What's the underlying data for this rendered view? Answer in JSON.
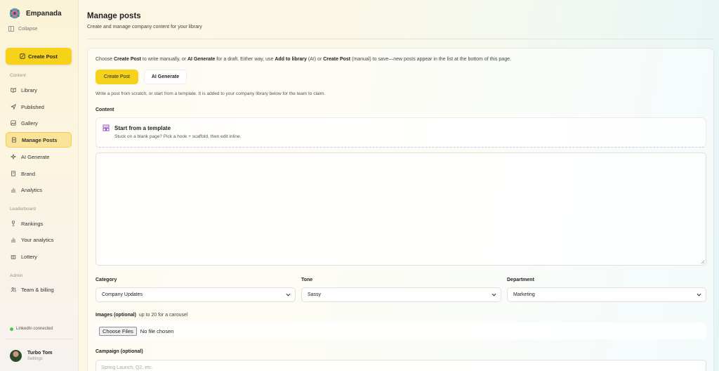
{
  "app": {
    "name": "Empanada",
    "collapse_label": "Collapse"
  },
  "sidebar": {
    "create_label": "Create Post",
    "sections": {
      "content": "Content",
      "leaderboard": "Leaderboard",
      "admin": "Admin"
    },
    "items": {
      "library": "Library",
      "published": "Published",
      "gallery": "Gallery",
      "manage_posts": "Manage Posts",
      "ai_generate": "AI Generate",
      "brand": "Brand",
      "analytics": "Analytics",
      "rankings": "Rankings",
      "your_analytics": "Your analytics",
      "lottery": "Lottery",
      "team_billing": "Team & billing"
    },
    "active_item": "Manage Posts",
    "linkedin_status": "LinkedIn connected",
    "user": {
      "name": "Turbo Tom",
      "sub": "Settings"
    }
  },
  "page": {
    "title": "Manage posts",
    "subtitle": "Create and manage company content for your library"
  },
  "intro": {
    "t1": "Choose ",
    "b1": "Create Post",
    "t2": " to write manually, or ",
    "b2": "AI Generate",
    "t3": " for a draft. Either way, use ",
    "b3": "Add to library",
    "t4": " (AI) or ",
    "b4": "Create Post",
    "t5": " (manual) to save—new posts appear in the list at the bottom of this page."
  },
  "mode_tabs": {
    "create": "Create Post",
    "ai": "AI Generate"
  },
  "help_text": "Write a post from scratch, or start from a template. It is added to your company library below for the team to claim.",
  "content": {
    "label": "Content",
    "template_title": "Start from a template",
    "template_sub": "Stuck on a blank page? Pick a hook + scaffold, then edit inline.",
    "text_value": ""
  },
  "fields": {
    "category": {
      "label": "Category",
      "value": "Company Updates"
    },
    "tone": {
      "label": "Tone",
      "value": "Sassy"
    },
    "department": {
      "label": "Department",
      "value": "Marketing"
    }
  },
  "images": {
    "label": "Images (optional)",
    "hint": "up to 20 for a carousel",
    "button": "Choose Files",
    "status": "No file chosen"
  },
  "campaign": {
    "label": "Campaign (optional)",
    "placeholder": "Spring Launch, Q2, etc."
  },
  "colors": {
    "accent": "#f7d21b",
    "active_bg": "#fbe39a",
    "connected": "#3ecf4e"
  }
}
